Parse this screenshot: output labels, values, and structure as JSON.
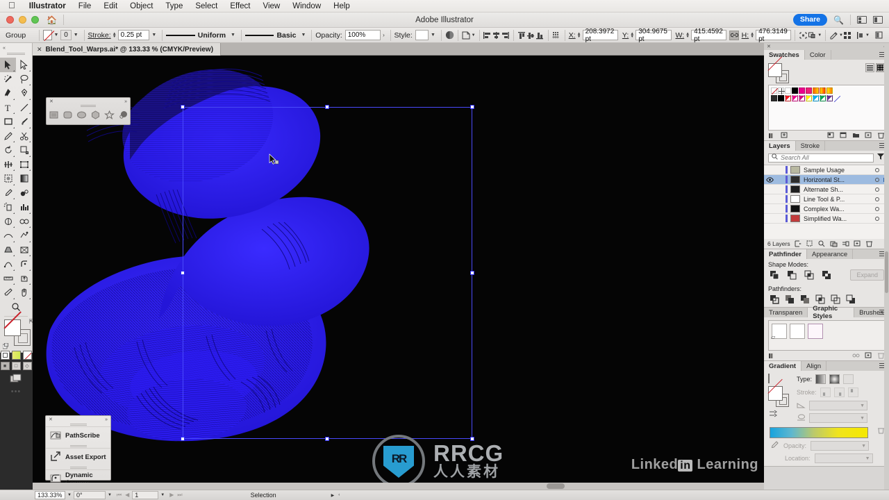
{
  "menubar": {
    "apple_icon": "apple-icon",
    "items": [
      "Illustrator",
      "File",
      "Edit",
      "Object",
      "Type",
      "Select",
      "Effect",
      "View",
      "Window",
      "Help"
    ]
  },
  "titlebar": {
    "title": "Adobe Illustrator",
    "home_icon": "home-icon",
    "share_label": "Share",
    "search_icon": "search-icon",
    "arrange_icon": "arrange-documents-icon",
    "workspace_icon": "workspace-switcher-icon"
  },
  "controlbar": {
    "selection_type": "Group",
    "fill_swatch": "none-fill-swatch",
    "stroke_swatch_value": "0",
    "stroke_label": "Stroke:",
    "stroke_weight": "0.25 pt",
    "variable_width_profile": "Uniform",
    "brush_definition": "Basic",
    "opacity_label": "Opacity:",
    "opacity_value": "100%",
    "style_label": "Style:",
    "recolor_icon": "recolor-artwork-icon",
    "select_similar_icon": "select-similar-objects-icon",
    "align_icons": [
      "align-left-icon",
      "align-horizontal-center-icon",
      "align-right-icon",
      "align-top-icon",
      "align-vertical-center-icon",
      "align-bottom-icon"
    ],
    "distribute_icon": "distribute-spacing-icon",
    "x_label": "X:",
    "x_value": "208.3972 pt",
    "y_label": "Y:",
    "y_value": "304.9675 pt",
    "w_label": "W:",
    "w_value": "415.4592 pt",
    "lock_proportions_icon": "link-chain-icon",
    "h_label": "H:",
    "h_value": "476.3149 pt",
    "transform_icon": "transform-icon",
    "arrange_objects_icon": "arrange-objects-icon",
    "isolate_icon": "isolate-selected-icon",
    "preferences_icon": "preferences-grid-icon",
    "properties_icon": "document-setup-icon",
    "more_options_icon": "more-options-icon"
  },
  "document_tab": {
    "close_icon": "close-tab-icon",
    "label": "Blend_Tool_Warps.ai* @ 133.33 % (CMYK/Preview)"
  },
  "toolbar": {
    "collapse_icon": "collapse-panel-icon",
    "tools": [
      {
        "name": "selection-tool",
        "selected": true
      },
      {
        "name": "direct-selection-tool",
        "selected": false
      },
      {
        "name": "magic-wand-tool",
        "selected": false
      },
      {
        "name": "lasso-tool",
        "selected": false
      },
      {
        "name": "pen-tool",
        "selected": false
      },
      {
        "name": "curvature-tool",
        "selected": false
      },
      {
        "name": "type-tool",
        "selected": false
      },
      {
        "name": "line-segment-tool",
        "selected": false
      },
      {
        "name": "rectangle-tool",
        "selected": false
      },
      {
        "name": "paintbrush-tool",
        "selected": false
      },
      {
        "name": "pencil-tool",
        "selected": false
      },
      {
        "name": "scissors-tool",
        "selected": false
      },
      {
        "name": "rotate-tool",
        "selected": false
      },
      {
        "name": "scale-tool",
        "selected": false
      },
      {
        "name": "width-tool",
        "selected": false
      },
      {
        "name": "free-transform-tool",
        "selected": false
      },
      {
        "name": "shape-builder-tool",
        "selected": false
      },
      {
        "name": "perspective-grid-tool",
        "selected": false
      },
      {
        "name": "mesh-tool",
        "selected": false
      },
      {
        "name": "gradient-tool",
        "selected": false
      },
      {
        "name": "eyedropper-tool",
        "selected": false
      },
      {
        "name": "blend-tool",
        "selected": false
      },
      {
        "name": "symbol-sprayer-tool",
        "selected": false
      },
      {
        "name": "column-graph-tool",
        "selected": false
      },
      {
        "name": "artboard-tool",
        "selected": false
      },
      {
        "name": "slice-tool",
        "selected": false
      },
      {
        "name": "puppet-warp-tool",
        "selected": false
      },
      {
        "name": "free-distort-tool",
        "selected": false
      },
      {
        "name": "pathscribe-tool",
        "selected": false
      },
      {
        "name": "dynamic-corners-tool",
        "selected": false
      },
      {
        "name": "measure-tool",
        "selected": false
      },
      {
        "name": "asset-export-tool",
        "selected": false
      },
      {
        "name": "eraser-tool",
        "selected": false
      },
      {
        "name": "hand-tool",
        "selected": false
      },
      {
        "name": "zoom-tool",
        "selected": false
      }
    ],
    "fill_color": "none",
    "stroke_color": "#e6e4e2",
    "color_modes": [
      "solid-color-mode",
      "gradient-color-mode",
      "none-color-mode"
    ],
    "draw_modes": [
      "draw-normal",
      "draw-behind",
      "draw-inside"
    ],
    "screen_mode": "change-screen-mode",
    "more": "edit-toolbar-icon"
  },
  "floating_shapes_panel": {
    "close_icon": "close-icon",
    "expand_icon": "expand-icon",
    "shapes": [
      "rectangle-shape-icon",
      "rounded-rectangle-shape-icon",
      "ellipse-shape-icon",
      "polygon-shape-icon",
      "star-shape-icon",
      "flare-shape-icon"
    ]
  },
  "floating_tools_panel": {
    "close_icon": "close-icon",
    "expand_icon": "expand-icon",
    "items": [
      {
        "icon": "pathscribe-icon",
        "label": "PathScribe"
      },
      {
        "icon": "asset-export-icon",
        "label": "Asset Export"
      },
      {
        "icon": "dynamic-corners-icon",
        "label": "Dynamic Corners"
      }
    ]
  },
  "canvas": {
    "artwork_name": "blue-cobra-wireframe-blend-artwork",
    "artwork_color": "#2b1bf0",
    "background_color": "#050505",
    "selection_color": "#4a4afc",
    "cursor": "selection-arrow-cursor"
  },
  "watermark": {
    "logo": "rrcg-logo-icon",
    "brand": "RRCG",
    "subtitle": "人人素材",
    "linkedin_prefix": "Linked",
    "linkedin_in": "in",
    "linkedin_suffix": "Learning"
  },
  "swatches_panel": {
    "tabs": [
      "Swatches",
      "Color"
    ],
    "active_tab": "Swatches",
    "menu_icon": "panel-menu-icon",
    "view_list_icon": "list-view-icon",
    "view_grid_icon": "grid-view-icon",
    "row1": [
      "none",
      "registration",
      "#ffffff",
      "#000000",
      "#ec008c",
      "#ed1e79",
      "gradient-warm",
      "gradient-rainbow",
      "gradient-orange"
    ],
    "row2": [
      "folder",
      "#000000",
      "#ed1c24",
      "#ec008c",
      "#ec008c",
      "#fff200",
      "#00aeef",
      "#00a651",
      "#662d91",
      "slash"
    ],
    "footer_icons": [
      "swatch-libraries-icon",
      "color-groups-icon",
      "show-options-icon",
      "new-color-group-icon",
      "new-folder-icon",
      "new-swatch-icon",
      "delete-swatch-icon"
    ]
  },
  "layers_panel": {
    "tabs": [
      "Layers",
      "Stroke"
    ],
    "active_tab": "Layers",
    "menu_icon": "panel-menu-icon",
    "search_placeholder": "Search All",
    "search_value": "",
    "filter_icon": "filter-icon",
    "layers": [
      {
        "name": "Sample Usage",
        "visible": false,
        "selected": false,
        "thumb": "#b8b8a0"
      },
      {
        "name": "Horizontal St...",
        "visible": true,
        "selected": true,
        "thumb": "#2d2d2d"
      },
      {
        "name": "Alternate Sh...",
        "visible": false,
        "selected": false,
        "thumb": "#1f1f1f"
      },
      {
        "name": "Line Tool & P...",
        "visible": false,
        "selected": false,
        "thumb": "#ffffff"
      },
      {
        "name": "Complex Wa...",
        "visible": false,
        "selected": false,
        "thumb": "#111111"
      },
      {
        "name": "Simplified Wa...",
        "visible": false,
        "selected": false,
        "thumb": "#c23b3b"
      }
    ],
    "count_label": "6 Layers",
    "footer_icons": [
      "locate-object-icon",
      "make-clipping-mask-icon",
      "create-new-sublayer-icon",
      "collect-in-new-layer-icon",
      "create-new-layer-icon",
      "delete-layer-icon"
    ]
  },
  "pathfinder_panel": {
    "tabs": [
      "Pathfinder",
      "Appearance"
    ],
    "active_tab": "Pathfinder",
    "menu_icon": "panel-menu-icon",
    "shape_modes_label": "Shape Modes:",
    "shape_modes": [
      "unite-icon",
      "minus-front-icon",
      "intersect-icon",
      "exclude-icon"
    ],
    "expand_label": "Expand",
    "pathfinders_label": "Pathfinders:",
    "pathfinders": [
      "divide-icon",
      "trim-icon",
      "merge-icon",
      "crop-icon",
      "outline-icon",
      "minus-back-icon"
    ]
  },
  "graphic_styles_panel": {
    "tabs": [
      "Transparen",
      "Graphic Styles",
      "Brushes"
    ],
    "active_tab": "Graphic Styles",
    "menu_icon": "panel-menu-icon",
    "styles": [
      "default-style",
      "blank-style",
      "pink-outline-style"
    ],
    "footer_icons": [
      "graphic-styles-libraries-icon",
      "break-link-icon",
      "new-graphic-style-icon",
      "delete-graphic-style-icon"
    ]
  },
  "gradient_panel": {
    "tabs": [
      "Gradient",
      "Align"
    ],
    "active_tab": "Gradient",
    "menu_icon": "panel-menu-icon",
    "type_label": "Type:",
    "type_options": [
      "linear-gradient-icon",
      "radial-gradient-icon",
      "freeform-gradient-icon"
    ],
    "stroke_label": "Stroke:",
    "stroke_options": [
      "stroke-within-icon",
      "stroke-along-icon",
      "stroke-across-icon"
    ],
    "angle_label": "angle-field",
    "angle_value": "",
    "aspect_label": "aspect-ratio-field",
    "aspect_value": "",
    "gradient_preview": "blue-to-yellow-gradient",
    "opacity_label": "Opacity:",
    "opacity_value": "",
    "location_label": "Location:",
    "location_value": "",
    "eyedropper_icon": "gradient-eyedropper-icon",
    "delete_stop_icon": "delete-stop-icon",
    "reverse_icon": "reverse-gradient-icon"
  },
  "statusbar": {
    "zoom_value": "133.33%",
    "rotation_value": "0°",
    "artboard_value": "1",
    "status_text": "Selection",
    "first_icon": "first-artboard-icon",
    "prev_icon": "previous-artboard-icon",
    "next_icon": "next-artboard-icon",
    "last_icon": "last-artboard-icon"
  }
}
